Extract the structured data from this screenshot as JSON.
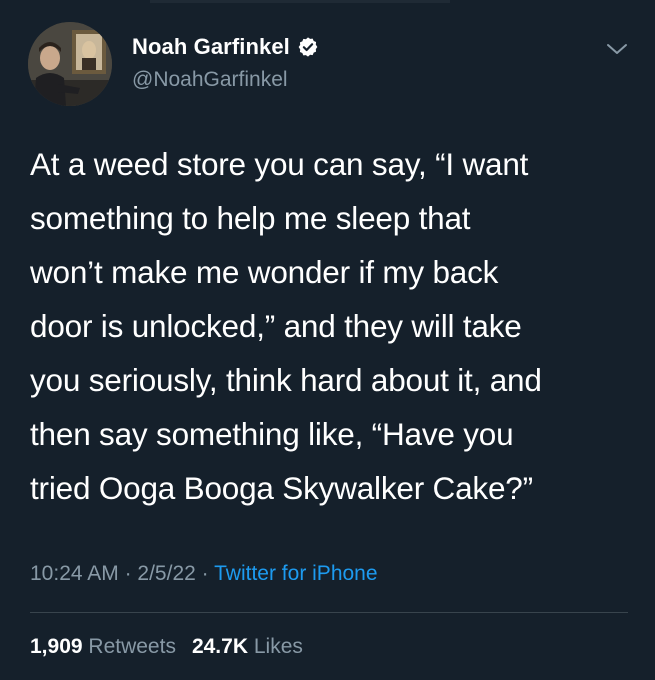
{
  "tweet": {
    "author": {
      "display_name": "Noah Garfinkel",
      "handle": "@NoahGarfinkel",
      "verified": true
    },
    "text": "At a weed store you can say, “I want\nsomething to help me sleep that\nwon’t make me wonder if my back\ndoor is unlocked,” and they will take\nyou seriously, think hard about it, and\nthen say something like, “Have you\ntried Ooga Booga Skywalker Cake?”",
    "time": "10:24 AM",
    "separator": "·",
    "date": "2/5/22",
    "source": "Twitter for iPhone",
    "retweets": {
      "count": "1,909",
      "label": "Retweets"
    },
    "likes": {
      "count": "24.7K",
      "label": "Likes"
    }
  },
  "colors": {
    "background": "#15202b",
    "text_primary": "#ffffff",
    "text_secondary": "#8899a6",
    "link": "#1d9bf0",
    "divider": "#38444d"
  },
  "icons": {
    "verified": "verified-badge-icon",
    "more": "chevron-down-icon"
  }
}
